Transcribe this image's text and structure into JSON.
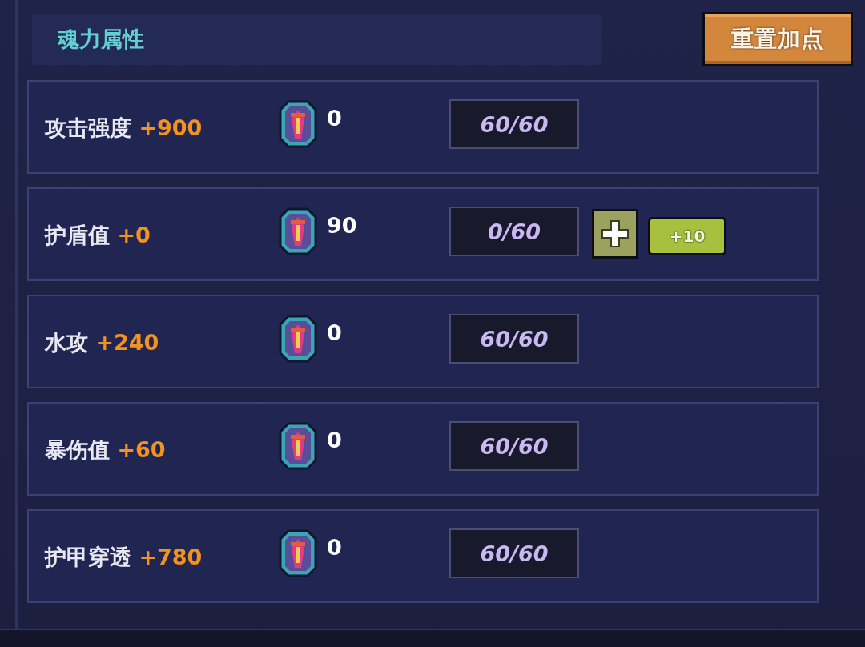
{
  "header": {
    "title": "魂力属性",
    "reset_button": "重置加点"
  },
  "attributes": [
    {
      "name": "攻击强度",
      "bonus": "+900",
      "cost": "0",
      "progress": "60/60"
    },
    {
      "name": "护盾值",
      "bonus": "+0",
      "cost": "90",
      "progress": "0/60",
      "add_step": "+10"
    },
    {
      "name": "水攻",
      "bonus": "+240",
      "cost": "0",
      "progress": "60/60"
    },
    {
      "name": "暴伤值",
      "bonus": "+60",
      "cost": "0",
      "progress": "60/60"
    },
    {
      "name": "护甲穿透",
      "bonus": "+780",
      "cost": "0",
      "progress": "60/60"
    }
  ]
}
